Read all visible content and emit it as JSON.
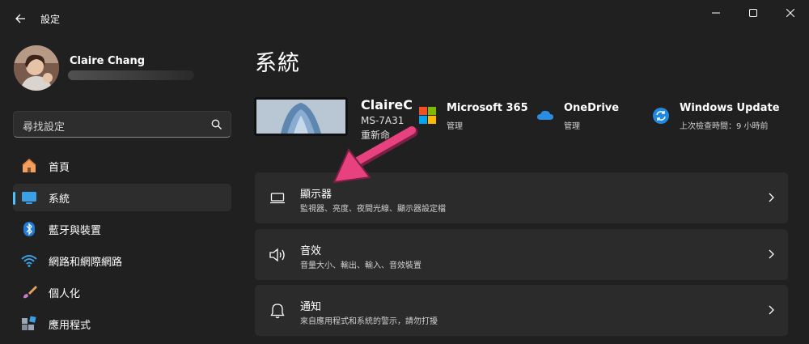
{
  "window": {
    "title": "設定"
  },
  "user": {
    "name": "Claire Chang"
  },
  "search": {
    "placeholder": "尋找設定"
  },
  "sidebar": {
    "items": [
      {
        "label": "首頁",
        "icon": "home-icon"
      },
      {
        "label": "系統",
        "icon": "monitor-icon",
        "active": true
      },
      {
        "label": "藍牙與裝置",
        "icon": "bluetooth-icon"
      },
      {
        "label": "網路和網際網路",
        "icon": "wifi-icon"
      },
      {
        "label": "個人化",
        "icon": "brush-icon"
      },
      {
        "label": "應用程式",
        "icon": "apps-icon"
      }
    ]
  },
  "main": {
    "title": "系統",
    "device": {
      "name": "ClaireC",
      "model": "MS-7A31",
      "rename": "重新命"
    },
    "quick": [
      {
        "title": "Microsoft 365",
        "sub": "管理",
        "icon": "microsoft-logo-icon"
      },
      {
        "title": "OneDrive",
        "sub": "管理",
        "icon": "onedrive-icon"
      },
      {
        "title": "Windows Update",
        "sub": "上次檢查時間：9 小時前",
        "icon": "windows-update-icon"
      }
    ],
    "cards": [
      {
        "title": "顯示器",
        "sub": "監視器、亮度、夜間光線、顯示器設定檔",
        "icon": "display-icon"
      },
      {
        "title": "音效",
        "sub": "音量大小、輸出、輸入、音效裝置",
        "icon": "speaker-icon"
      },
      {
        "title": "通知",
        "sub": "來自應用程式和系統的警示，請勿打擾",
        "icon": "bell-icon"
      }
    ]
  },
  "colors": {
    "accent": "#4cc2ff",
    "annotation_arrow": "#e8417f",
    "background": "#202020",
    "card": "#2b2b2b"
  }
}
